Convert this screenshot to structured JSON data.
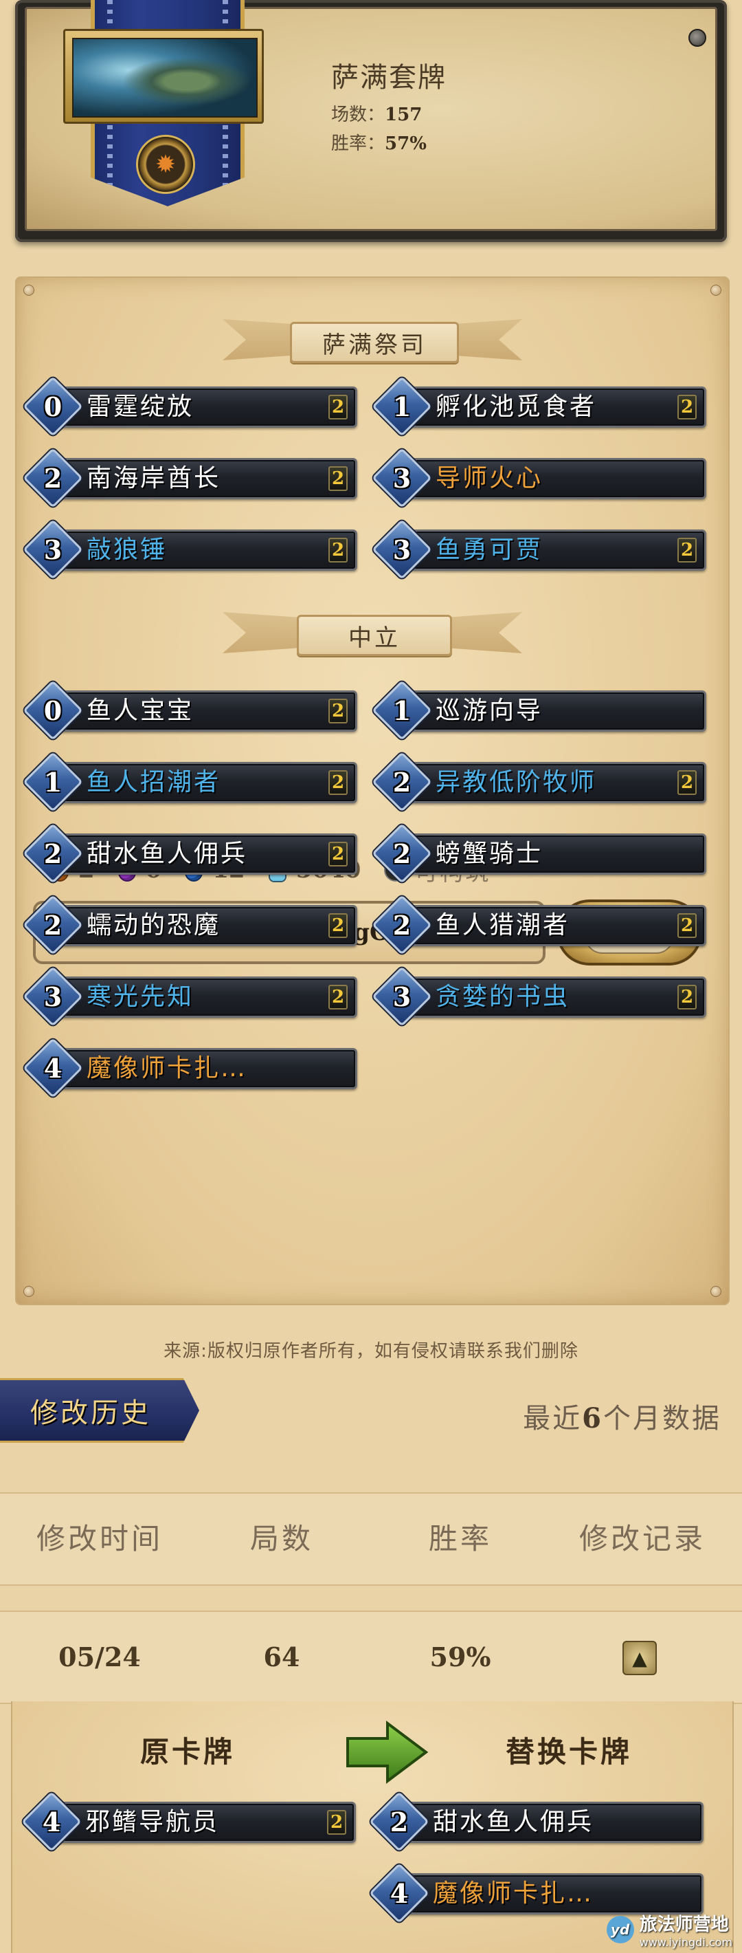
{
  "header": {
    "deck_name": "萨满套牌",
    "games_label": "场数：",
    "games_value": "157",
    "winrate_label": "胜率：",
    "winrate_value": "57%",
    "class_icon": "horde-shaman-emblem-icon"
  },
  "sections": [
    {
      "title": "萨满祭司",
      "cards": [
        {
          "cost": "0",
          "name": "雷霆绽放",
          "count": "2",
          "rarity": "common"
        },
        {
          "cost": "1",
          "name": "孵化池觅食者",
          "count": "2",
          "rarity": "common"
        },
        {
          "cost": "2",
          "name": "南海岸酋长",
          "count": "2",
          "rarity": "common"
        },
        {
          "cost": "3",
          "name": "导师火心",
          "count": "",
          "rarity": "legendary"
        },
        {
          "cost": "3",
          "name": "敲狼锤",
          "count": "2",
          "rarity": "rare"
        },
        {
          "cost": "3",
          "name": "鱼勇可贾",
          "count": "2",
          "rarity": "rare"
        }
      ]
    },
    {
      "title": "中立",
      "cards": [
        {
          "cost": "0",
          "name": "鱼人宝宝",
          "count": "2",
          "rarity": "common"
        },
        {
          "cost": "1",
          "name": "巡游向导",
          "count": "",
          "rarity": "common"
        },
        {
          "cost": "1",
          "name": "鱼人招潮者",
          "count": "2",
          "rarity": "rare"
        },
        {
          "cost": "2",
          "name": "异教低阶牧师",
          "count": "2",
          "rarity": "rare"
        },
        {
          "cost": "2",
          "name": "甜水鱼人佣兵",
          "count": "2",
          "rarity": "common"
        },
        {
          "cost": "2",
          "name": "螃蟹骑士",
          "count": "",
          "rarity": "common"
        },
        {
          "cost": "2",
          "name": "蠕动的恐魔",
          "count": "2",
          "rarity": "common"
        },
        {
          "cost": "2",
          "name": "鱼人猎潮者",
          "count": "2",
          "rarity": "common"
        },
        {
          "cost": "3",
          "name": "寒光先知",
          "count": "2",
          "rarity": "rare"
        },
        {
          "cost": "3",
          "name": "贪婪的书虫",
          "count": "2",
          "rarity": "rare"
        },
        {
          "cost": "4",
          "name": "魔像师卡扎…",
          "count": "",
          "rarity": "legendary"
        }
      ]
    }
  ],
  "rarity_counts": {
    "legendary": "2",
    "epic": "0",
    "rare": "12",
    "dust": "5040",
    "craftable_label": "可构筑"
  },
  "deck_code": "AAECAZnDAwSbzQOczgOR5A...",
  "copy_label": "复制",
  "source_note": "来源:版权归原作者所有，如有侵权请联系我们删除",
  "history": {
    "tab_label": "修改历史",
    "recent_prefix": "最近",
    "recent_number": "6",
    "recent_suffix": "个月数据",
    "columns": [
      "修改时间",
      "局数",
      "胜率",
      "修改记录"
    ],
    "row": {
      "date": "05/24",
      "games": "64",
      "winrate": "59%"
    },
    "original_title": "原卡牌",
    "replacement_title": "替换卡牌",
    "removed": [
      {
        "cost": "4",
        "name": "邪鳍导航员",
        "count": "2",
        "rarity": "common"
      }
    ],
    "added": [
      {
        "cost": "2",
        "name": "甜水鱼人佣兵",
        "count": "",
        "rarity": "common"
      },
      {
        "cost": "4",
        "name": "魔像师卡扎…",
        "count": "",
        "rarity": "legendary"
      }
    ]
  },
  "watermark": {
    "name": "旅法师营地",
    "url": "www.iyingdi.com",
    "logo_text": "yd"
  },
  "colors": {
    "rare": "#4fb3ea",
    "legendary": "#f0a23a",
    "common": "#ffffff",
    "count": "#f3c83a"
  }
}
